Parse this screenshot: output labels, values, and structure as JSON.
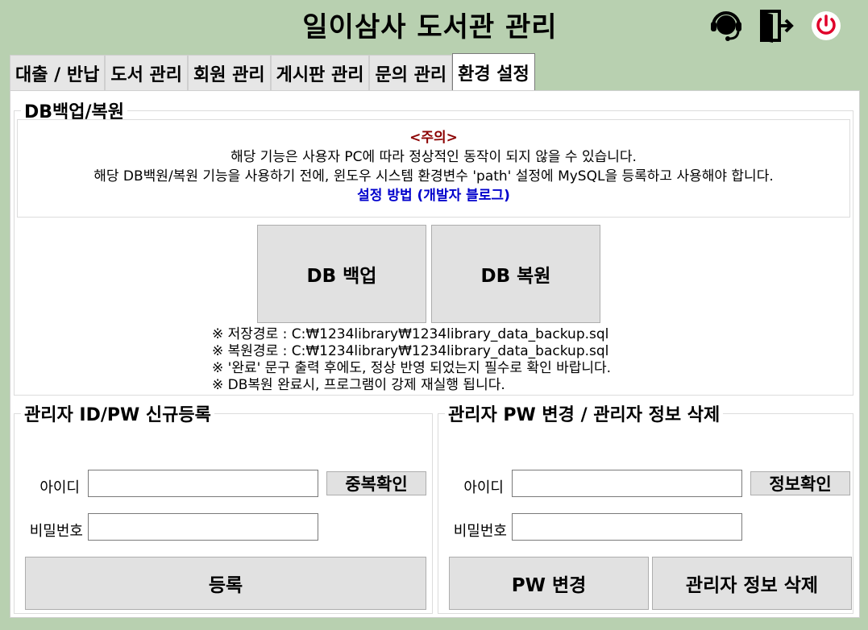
{
  "app": {
    "title": "일이삼사 도서관 관리"
  },
  "header_icons": [
    "headset-icon",
    "exit-door-icon",
    "power-icon"
  ],
  "tabs": [
    {
      "label": "대출 / 반납"
    },
    {
      "label": "도서 관리"
    },
    {
      "label": "회원 관리"
    },
    {
      "label": "게시판 관리"
    },
    {
      "label": "문의 관리"
    },
    {
      "label": "환경 설정"
    }
  ],
  "backup": {
    "legend": "DB백업/복원",
    "notice_title": "<주의>",
    "notice_line1": "해당 기능은 사용자 PC에 따라 정상적인 동작이 되지 않을 수 있습니다.",
    "notice_line2": "해당 DB백원/복원 기능을 사용하기 전에, 윈도우 시스템 환경변수 'path' 설정에 MySQL을 등록하고 사용해야 합니다.",
    "guide_link": "설정 방법 (개발자 블로그)",
    "backup_button": "DB 백업",
    "restore_button": "DB 복원",
    "paths": [
      "※ 저장경로 : C:₩1234library₩1234library_data_backup.sql",
      "※ 복원경로 : C:₩1234library₩1234library_data_backup.sql",
      "※ '완료' 문구 출력 후에도, 정상 반영 되었는지 필수로 확인 바랍니다.",
      "※ DB복원 완료시, 프로그램이 강제 재실행 됩니다."
    ]
  },
  "register": {
    "legend": "관리자 ID/PW 신규등록",
    "id_label": "아이디",
    "pw_label": "비밀번호",
    "id_value": "",
    "pw_value": "",
    "dup_check_button": "중복확인",
    "register_button": "등록"
  },
  "modify": {
    "legend": "관리자 PW 변경 / 관리자 정보 삭제",
    "id_label": "아이디",
    "pw_label": "비밀번호",
    "id_value": "",
    "pw_value": "",
    "info_check_button": "정보확인",
    "pw_change_button": "PW 변경",
    "delete_button": "관리자 정보 삭제"
  },
  "colors": {
    "background": "#b8d0b0",
    "warning": "#8b0000",
    "link": "#0000cc",
    "power": "#e0002a"
  }
}
